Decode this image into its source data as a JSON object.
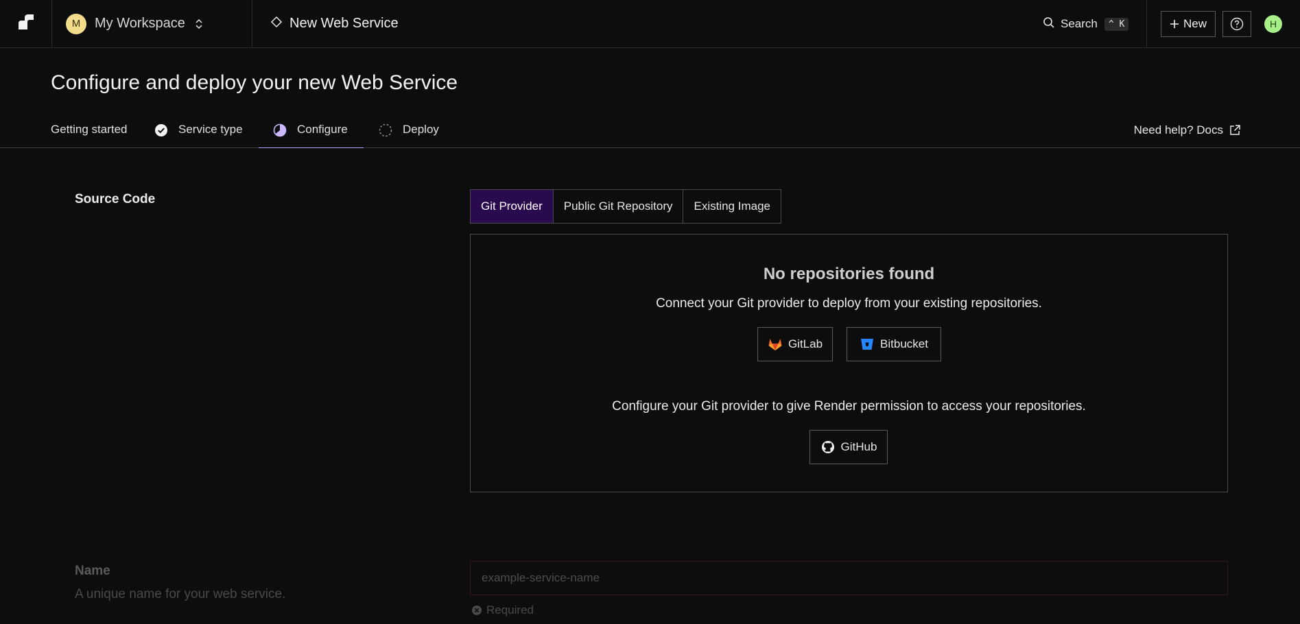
{
  "topbar": {
    "logo_icon": "render-logo-icon",
    "workspace": {
      "initial": "M",
      "name": "My Workspace",
      "avatar_color": "#f3dd8c"
    },
    "breadcrumb": {
      "icon": "diamond-icon",
      "label": "New Web Service"
    },
    "search": {
      "label": "Search",
      "shortcut": "^ K"
    },
    "new_button": "New",
    "help_icon": "question-circle-icon",
    "user": {
      "initial": "H",
      "avatar_color": "#a8ef8a"
    }
  },
  "page": {
    "title": "Configure and deploy your new Web Service",
    "steps": [
      {
        "label": "Getting started",
        "state": "done-plain"
      },
      {
        "label": "Service type",
        "state": "complete",
        "icon": "check-circle-icon"
      },
      {
        "label": "Configure",
        "state": "active",
        "icon": "half-circle-icon"
      },
      {
        "label": "Deploy",
        "state": "pending",
        "icon": "dashed-circle-icon"
      }
    ],
    "help_link": "Need help? Docs"
  },
  "source_code": {
    "label": "Source Code",
    "tabs": [
      "Git Provider",
      "Public Git Repository",
      "Existing Image"
    ],
    "active_tab": "Git Provider",
    "panel": {
      "heading": "No repositories found",
      "connect_text": "Connect your Git provider to deploy from your existing repositories.",
      "providers": [
        {
          "label": "GitLab",
          "icon": "gitlab-icon"
        },
        {
          "label": "Bitbucket",
          "icon": "bitbucket-icon"
        }
      ],
      "configure_text": "Configure your Git provider to give Render permission to access your repositories.",
      "github": {
        "label": "GitHub",
        "icon": "github-icon"
      }
    }
  },
  "name_field": {
    "label": "Name",
    "description": "A unique name for your web service.",
    "placeholder": "example-service-name",
    "value": "",
    "validation": "Required"
  },
  "colors": {
    "background": "#0d0d0d",
    "active_tab_bg": "#2a0a4e",
    "active_step_underline": "#b9a3ff"
  }
}
